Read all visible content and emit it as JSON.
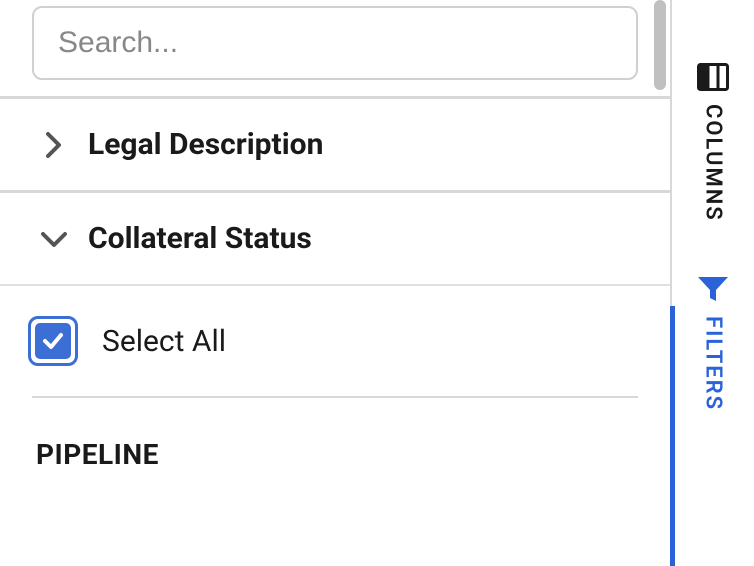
{
  "search": {
    "placeholder": "Search..."
  },
  "sections": {
    "legal_description": {
      "label": "Legal Description"
    },
    "collateral_status": {
      "label": "Collateral Status"
    }
  },
  "select_all": {
    "label": "Select All"
  },
  "groups": {
    "pipeline": {
      "label": "PIPELINE"
    }
  },
  "rail": {
    "columns": {
      "label": "COLUMNS"
    },
    "filters": {
      "label": "FILTERS"
    }
  }
}
